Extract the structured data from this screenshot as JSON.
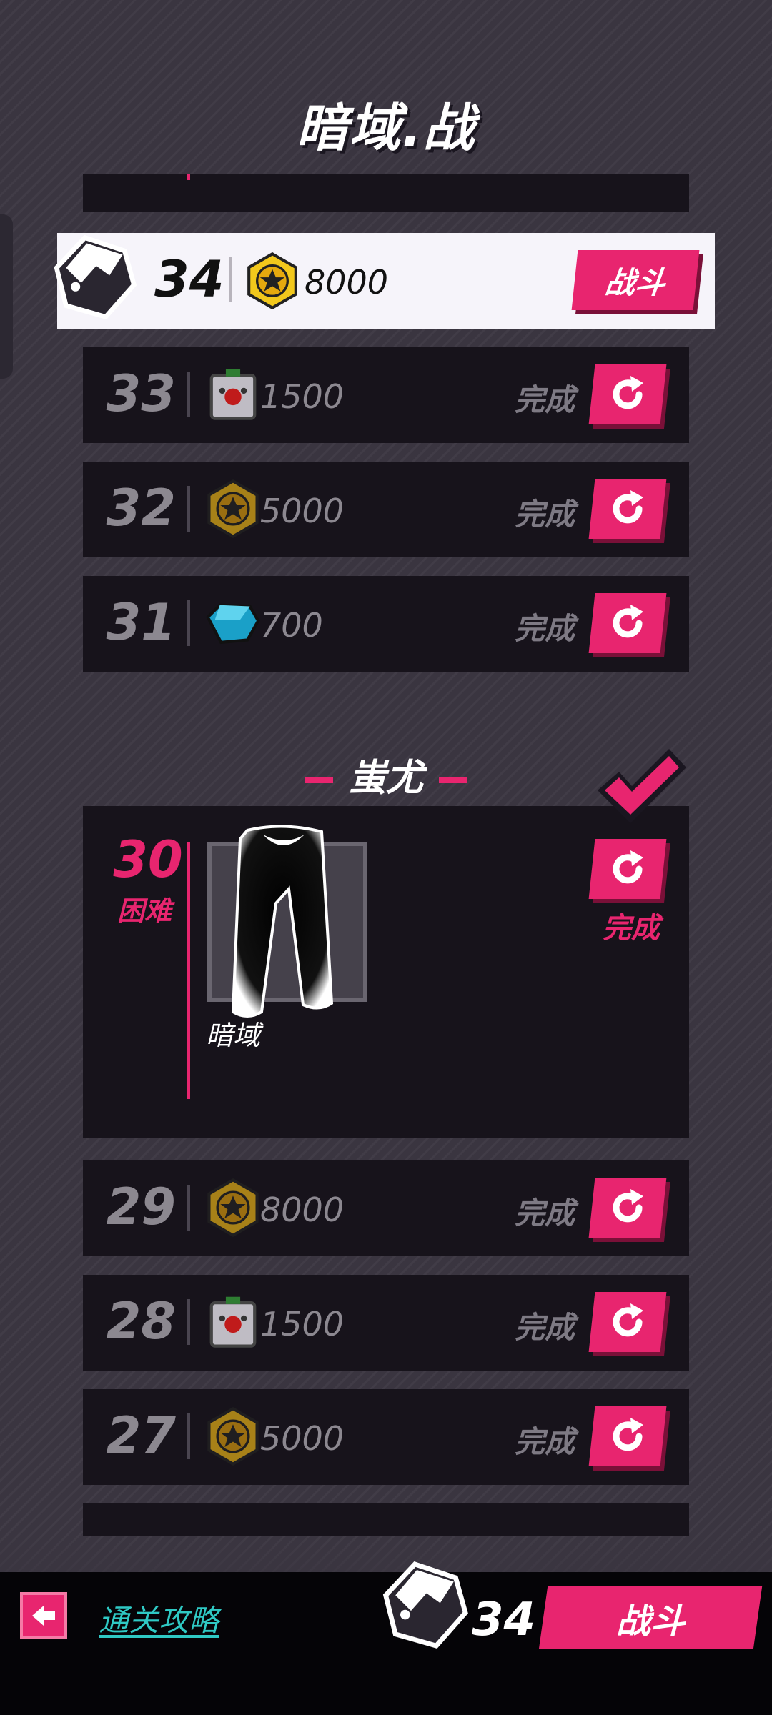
{
  "header": {
    "title": "暗域.战"
  },
  "current_level": {
    "level": "34",
    "reward_amount": "8000",
    "reward_icon": "gold-coin-icon",
    "fight_label": "战斗"
  },
  "levels_top": [
    {
      "level": "33",
      "reward_icon": "bomb-crate-icon",
      "reward_amount": "1500",
      "status": "完成"
    },
    {
      "level": "32",
      "reward_icon": "gold-coin-icon",
      "reward_amount": "5000",
      "status": "完成"
    },
    {
      "level": "31",
      "reward_icon": "blue-gem-icon",
      "reward_amount": "700",
      "status": "完成"
    }
  ],
  "boss": {
    "name": "蚩尤",
    "level": "30",
    "difficulty": "困难",
    "item_name": "暗域",
    "item_icon": "pants-icon",
    "status": "完成"
  },
  "levels_bottom": [
    {
      "level": "29",
      "reward_icon": "gold-coin-icon",
      "reward_amount": "8000",
      "status": "完成"
    },
    {
      "level": "28",
      "reward_icon": "bomb-crate-icon",
      "reward_amount": "1500",
      "status": "完成"
    },
    {
      "level": "27",
      "reward_icon": "gold-coin-icon",
      "reward_amount": "5000",
      "status": "完成"
    }
  ],
  "bottom_bar": {
    "guide_label": "通关攻略",
    "level": "34",
    "fight_label": "战斗"
  },
  "colors": {
    "accent": "#e8256f",
    "background": "#3a3540",
    "row": "#17131b",
    "link": "#2fc9c4"
  }
}
